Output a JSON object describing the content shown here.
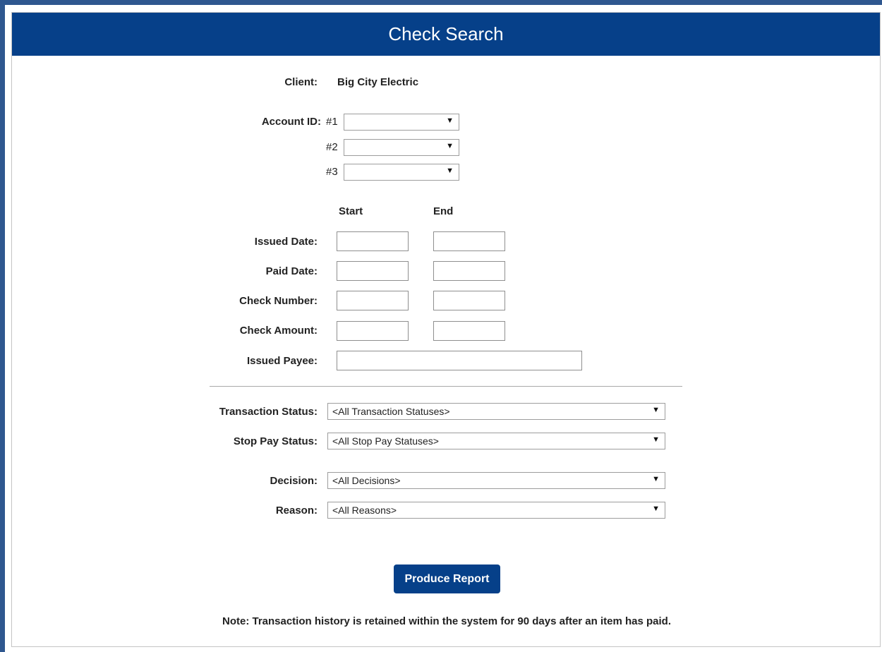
{
  "header": {
    "title": "Check Search"
  },
  "client": {
    "label": "Client:",
    "value": "Big City Electric"
  },
  "account": {
    "label": "Account ID:",
    "slots": [
      {
        "index": "#1",
        "value": ""
      },
      {
        "index": "#2",
        "value": ""
      },
      {
        "index": "#3",
        "value": ""
      }
    ]
  },
  "columns": {
    "start": "Start",
    "end": "End"
  },
  "ranges": [
    {
      "label": "Issued Date:",
      "start": "",
      "end": ""
    },
    {
      "label": "Paid Date:",
      "start": "",
      "end": ""
    },
    {
      "label": "Check Number:",
      "start": "",
      "end": ""
    },
    {
      "label": "Check Amount:",
      "start": "",
      "end": ""
    }
  ],
  "payee": {
    "label": "Issued Payee:",
    "value": ""
  },
  "filters": [
    {
      "label": "Transaction Status:",
      "selected": "<All Transaction Statuses>"
    },
    {
      "label": "Stop Pay Status:",
      "selected": "<All Stop Pay Statuses>"
    },
    {
      "label": "Decision:",
      "selected": "<All Decisions>"
    },
    {
      "label": "Reason:",
      "selected": "<All Reasons>"
    }
  ],
  "actions": {
    "produce_report": "Produce Report"
  },
  "footer": {
    "note": "Note: Transaction history is retained within the system for 90 days after an item has paid."
  },
  "icons": {
    "dropdown": "dropdown-arrow-icon"
  },
  "colors": {
    "brand": "#064089",
    "frame": "#2f578f"
  }
}
